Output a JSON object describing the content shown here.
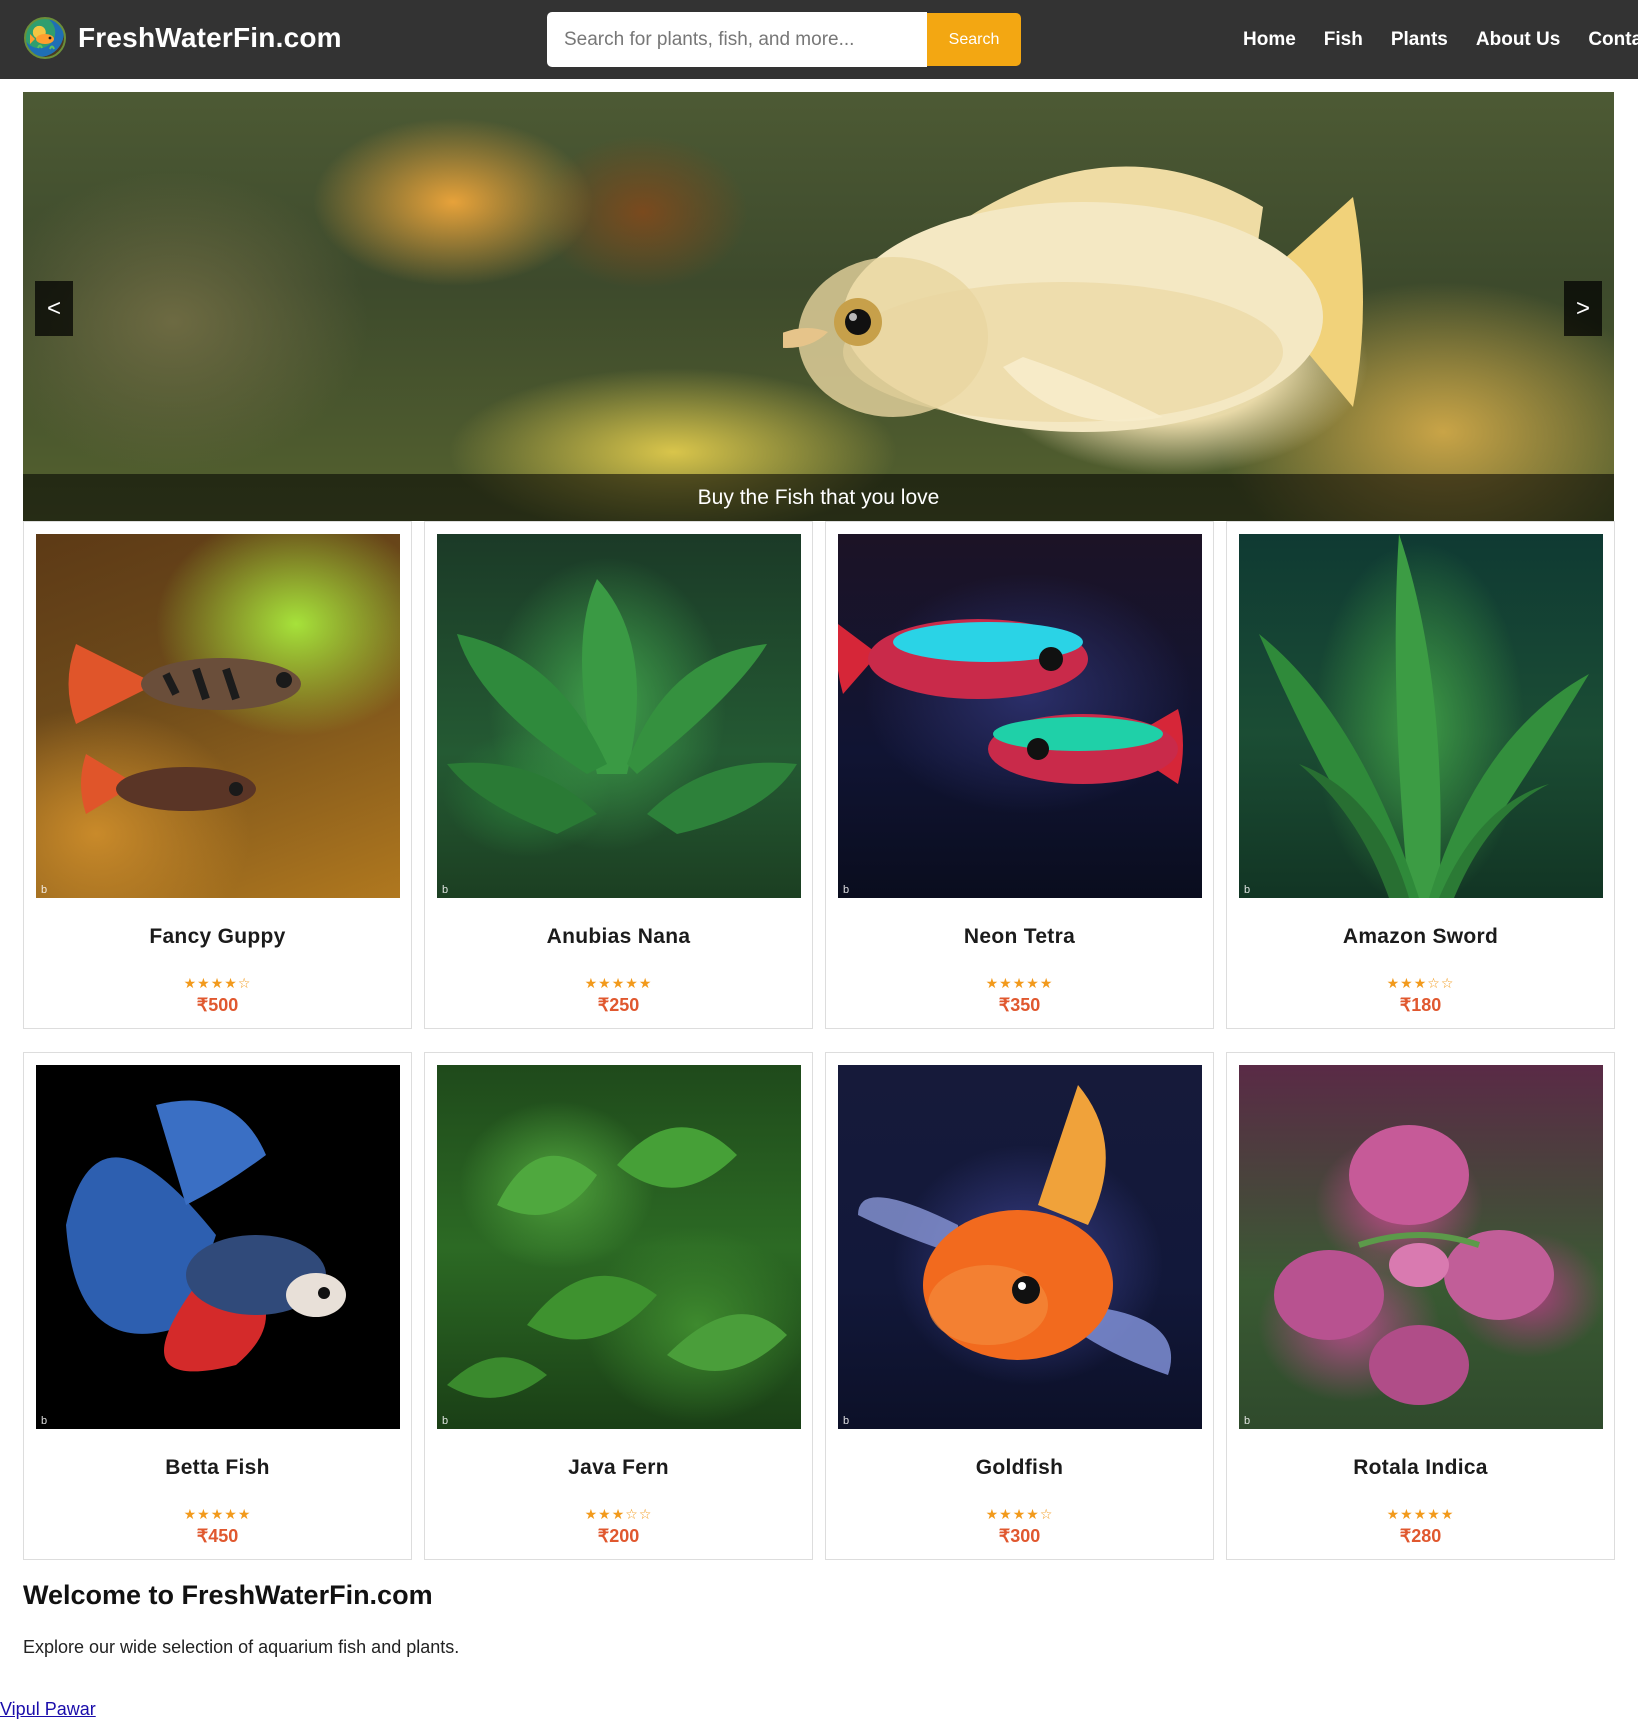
{
  "header": {
    "brand_name": "FreshWaterFin.com",
    "logo_icon": "fish-globe-logo-icon",
    "search": {
      "placeholder": "Search for plants, fish, and more...",
      "value": "",
      "button_label": "Search"
    },
    "nav": [
      "Home",
      "Fish",
      "Plants",
      "About Us",
      "Contac"
    ]
  },
  "hero": {
    "caption": "Buy the Fish that you love",
    "prev_label": "<",
    "next_label": ">"
  },
  "products": [
    {
      "name": "Fancy Guppy",
      "stars": "★★★★☆",
      "rating": 4,
      "price": "₹500",
      "image": "guppy"
    },
    {
      "name": "Anubias Nana",
      "stars": "★★★★★",
      "rating": 5,
      "price": "₹250",
      "image": "anubias"
    },
    {
      "name": "Neon Tetra",
      "stars": "★★★★★",
      "rating": 5,
      "price": "₹350",
      "image": "neon"
    },
    {
      "name": "Amazon Sword",
      "stars": "★★★☆☆",
      "rating": 3,
      "price": "₹180",
      "image": "sword"
    },
    {
      "name": "Betta Fish",
      "stars": "★★★★★",
      "rating": 5,
      "price": "₹450",
      "image": "betta"
    },
    {
      "name": "Java Fern",
      "stars": "★★★☆☆",
      "rating": 3,
      "price": "₹200",
      "image": "java"
    },
    {
      "name": "Goldfish",
      "stars": "★★★★☆",
      "rating": 4,
      "price": "₹300",
      "image": "goldfish"
    },
    {
      "name": "Rotala Indica",
      "stars": "★★★★★",
      "rating": 5,
      "price": "₹280",
      "image": "rotala"
    }
  ],
  "welcome": {
    "title": "Welcome to FreshWaterFin.com",
    "text": "Explore our wide selection of aquarium fish and plants."
  },
  "footer": {
    "author_link": "Vipul Pawar"
  },
  "colors": {
    "navbar_bg": "#333333",
    "search_button": "#f3a712",
    "star": "#f29a1c",
    "price": "#e0582f",
    "link": "#1a0dab"
  }
}
